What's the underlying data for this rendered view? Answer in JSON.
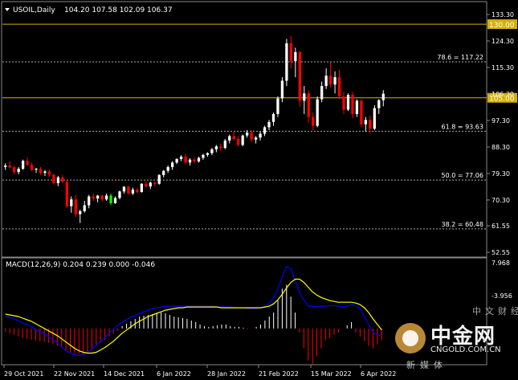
{
  "chart_data": {
    "type": "candlestick",
    "symbol_label": "USOIL,Daily",
    "ohlc_header": "104.20 107.58 102.09 106.37",
    "price_ticks": [
      "133.30",
      "124.30",
      "115.30",
      "106.30",
      "97.30",
      "88.30",
      "79.30",
      "70.30",
      "61.55",
      "52.55"
    ],
    "x_labels": [
      "29 Oct 2021",
      "22 Nov 2021",
      "14 Dec 2021",
      "6 Jan 2022",
      "28 Jan 2022",
      "21 Feb 2022",
      "15 Mar 2022",
      "6 Apr 2022"
    ],
    "candles": [
      [
        81.5,
        82.8,
        80.5,
        82.0
      ],
      [
        82.0,
        83.5,
        81.0,
        81.4
      ],
      [
        81.4,
        82.0,
        79.0,
        79.8
      ],
      [
        79.8,
        81.5,
        79.0,
        80.9
      ],
      [
        80.9,
        84.0,
        80.5,
        83.6
      ],
      [
        83.6,
        84.8,
        82.0,
        82.2
      ],
      [
        82.2,
        83.0,
        80.0,
        80.6
      ],
      [
        80.6,
        81.2,
        79.5,
        80.9
      ],
      [
        80.9,
        81.5,
        78.8,
        79.5
      ],
      [
        79.5,
        80.5,
        78.5,
        80.0
      ],
      [
        80.0,
        80.7,
        78.2,
        78.9
      ],
      [
        78.9,
        79.2,
        75.5,
        76.0
      ],
      [
        76.0,
        78.5,
        75.0,
        78.0
      ],
      [
        78.0,
        78.8,
        76.0,
        76.5
      ],
      [
        76.5,
        77.0,
        67.5,
        68.2
      ],
      [
        68.2,
        71.5,
        66.0,
        70.5
      ],
      [
        70.5,
        72.0,
        64.5,
        65.5
      ],
      [
        65.5,
        67.0,
        62.5,
        66.5
      ],
      [
        66.5,
        70.0,
        66.0,
        68.5
      ],
      [
        68.5,
        72.0,
        67.5,
        71.5
      ],
      [
        71.5,
        72.5,
        70.0,
        70.8
      ],
      [
        70.8,
        72.0,
        69.5,
        71.8
      ],
      [
        71.8,
        72.0,
        69.8,
        70.5
      ],
      [
        70.5,
        72.5,
        70.0,
        71.8
      ],
      [
        71.8,
        72.5,
        68.5,
        69.2
      ],
      [
        69.2,
        71.5,
        69.0,
        71.0
      ],
      [
        71.0,
        73.5,
        70.5,
        73.2
      ],
      [
        73.2,
        75.0,
        72.5,
        74.8
      ],
      [
        74.8,
        75.0,
        72.0,
        72.5
      ],
      [
        72.5,
        74.5,
        72.0,
        73.8
      ],
      [
        73.8,
        74.5,
        72.5,
        73.0
      ],
      [
        73.0,
        76.0,
        72.8,
        75.8
      ],
      [
        75.8,
        76.8,
        74.5,
        74.9
      ],
      [
        74.9,
        76.5,
        74.0,
        76.2
      ],
      [
        76.2,
        76.5,
        75.0,
        75.8
      ],
      [
        75.8,
        79.0,
        75.5,
        78.8
      ],
      [
        78.8,
        80.5,
        78.0,
        80.2
      ],
      [
        80.2,
        82.0,
        79.5,
        81.5
      ],
      [
        81.5,
        83.5,
        80.5,
        83.0
      ],
      [
        83.0,
        84.5,
        82.5,
        84.2
      ],
      [
        84.2,
        85.5,
        83.5,
        85.0
      ],
      [
        85.0,
        86.0,
        82.5,
        83.0
      ],
      [
        83.0,
        84.5,
        82.0,
        84.0
      ],
      [
        84.0,
        84.8,
        82.8,
        83.4
      ],
      [
        83.4,
        85.0,
        83.0,
        84.6
      ],
      [
        84.6,
        86.0,
        84.0,
        85.6
      ],
      [
        85.6,
        86.5,
        85.0,
        86.2
      ],
      [
        86.2,
        88.0,
        85.5,
        87.5
      ],
      [
        87.5,
        89.0,
        86.5,
        88.5
      ],
      [
        88.5,
        89.5,
        87.0,
        88.0
      ],
      [
        88.0,
        91.0,
        87.5,
        90.5
      ],
      [
        90.5,
        92.5,
        89.5,
        92.0
      ],
      [
        92.0,
        93.5,
        90.5,
        91.0
      ],
      [
        91.0,
        92.0,
        88.5,
        89.0
      ],
      [
        89.0,
        92.5,
        88.5,
        92.2
      ],
      [
        92.2,
        94.0,
        91.5,
        93.2
      ],
      [
        93.2,
        94.0,
        90.0,
        90.8
      ],
      [
        90.8,
        92.0,
        89.5,
        91.5
      ],
      [
        91.5,
        93.5,
        90.5,
        92.8
      ],
      [
        92.8,
        95.5,
        92.0,
        95.0
      ],
      [
        95.0,
        97.5,
        94.0,
        96.8
      ],
      [
        96.8,
        100.0,
        95.5,
        99.5
      ],
      [
        99.5,
        105.5,
        98.5,
        104.8
      ],
      [
        104.8,
        112.0,
        103.5,
        110.8
      ],
      [
        110.8,
        125.0,
        109.0,
        123.5
      ],
      [
        123.5,
        126.0,
        115.0,
        117.5
      ],
      [
        117.5,
        122.0,
        112.0,
        120.5
      ],
      [
        120.5,
        121.0,
        102.0,
        104.0
      ],
      [
        104.0,
        109.0,
        99.5,
        106.5
      ],
      [
        106.5,
        107.5,
        96.5,
        98.5
      ],
      [
        98.5,
        100.0,
        94.0,
        95.5
      ],
      [
        95.5,
        105.5,
        95.0,
        104.5
      ],
      [
        104.5,
        110.5,
        103.5,
        109.0
      ],
      [
        109.0,
        115.0,
        108.0,
        112.5
      ],
      [
        112.5,
        117.0,
        108.5,
        109.5
      ],
      [
        109.5,
        114.0,
        106.5,
        112.0
      ],
      [
        112.0,
        114.5,
        104.5,
        105.5
      ],
      [
        105.5,
        107.0,
        99.5,
        101.0
      ],
      [
        101.0,
        106.5,
        100.5,
        106.0
      ],
      [
        106.0,
        107.0,
        98.0,
        99.5
      ],
      [
        99.5,
        104.5,
        98.5,
        104.0
      ],
      [
        104.0,
        104.5,
        95.0,
        96.0
      ],
      [
        96.0,
        98.5,
        93.5,
        97.5
      ],
      [
        97.5,
        99.0,
        93.0,
        94.5
      ],
      [
        94.5,
        102.5,
        94.0,
        101.5
      ],
      [
        101.5,
        104.5,
        99.5,
        104.2
      ],
      [
        104.2,
        107.6,
        102.1,
        106.4
      ]
    ],
    "hlines": [
      {
        "value": 130.0,
        "label": "130.00",
        "style": "solid",
        "color": "#d4b000"
      },
      {
        "value": 117.22,
        "label": "78.6 = 117.22",
        "style": "dash",
        "color": "#aaaaaa"
      },
      {
        "value": 105.0,
        "label": "105.00",
        "style": "solid",
        "color": "#d4b000"
      },
      {
        "value": 93.63,
        "label": "61.8 = 93.63",
        "style": "dash",
        "color": "#aaaaaa"
      },
      {
        "value": 77.06,
        "label": "50.0 = 77.06",
        "style": "dash",
        "color": "#aaaaaa"
      },
      {
        "value": 60.48,
        "label": "38.2 = 60.48",
        "style": "dash",
        "color": "#aaaaaa"
      }
    ],
    "macd": {
      "header": "MACD(12,26,9) 0.204 0.239 0.000 -0.046",
      "ticks": [
        "7.968",
        "-3.956"
      ],
      "hist": [
        -0.4,
        -0.6,
        -0.8,
        -1.0,
        -1.2,
        -1.3,
        -1.4,
        -1.5,
        -1.6,
        -1.7,
        -1.8,
        -2.0,
        -2.2,
        -2.4,
        -2.8,
        -3.0,
        -3.1,
        -3.2,
        -3.2,
        -3.0,
        -2.6,
        -2.2,
        -1.8,
        -1.4,
        -1.0,
        -0.6,
        -0.3,
        0.3,
        0.6,
        0.9,
        1.2,
        1.5,
        1.6,
        1.7,
        1.8,
        1.9,
        2.0,
        1.9,
        1.7,
        1.5,
        1.4,
        1.3,
        1.2,
        1.0,
        0.8,
        0.5,
        0.3,
        0.2,
        0.3,
        0.4,
        0.5,
        0.5,
        0.3,
        0.2,
        0.2,
        0.1,
        -0.1,
        0.0,
        0.2,
        0.5,
        1.0,
        1.5,
        2.0,
        3.5,
        5.0,
        5.5,
        4.0,
        2.0,
        -0.5,
        -2.5,
        -4.0,
        -4.5,
        -3.5,
        -2.5,
        -1.5,
        -1.2,
        -0.8,
        -0.5,
        0.0,
        0.4,
        0.8,
        -0.5,
        -1.0,
        -1.6,
        -2.2,
        -2.5,
        -2.0,
        -1.5
      ],
      "line": [
        1.5,
        1.4,
        1.2,
        1.0,
        0.7,
        0.5,
        0.2,
        -0.1,
        -0.4,
        -0.7,
        -1.0,
        -1.4,
        -1.8,
        -2.3,
        -2.8,
        -3.1,
        -3.3,
        -3.4,
        -3.3,
        -3.0,
        -2.6,
        -2.1,
        -1.6,
        -1.1,
        -0.6,
        -0.1,
        0.4,
        0.8,
        1.1,
        1.4,
        1.6,
        1.9,
        2.1,
        2.3,
        2.5,
        2.6,
        2.7,
        2.8,
        2.8,
        2.8,
        2.8,
        2.8,
        2.8,
        2.8,
        2.8,
        2.8,
        2.8,
        2.8,
        2.8,
        2.7,
        2.7,
        2.7,
        2.7,
        2.6,
        2.6,
        2.6,
        2.5,
        2.5,
        2.5,
        2.6,
        2.8,
        3.2,
        3.8,
        5.0,
        6.5,
        7.8,
        7.5,
        6.0,
        4.5,
        3.6,
        2.8,
        2.8,
        2.7,
        2.8,
        2.8,
        2.9,
        2.9,
        2.8,
        2.7,
        2.8,
        3.0,
        2.9,
        2.5,
        1.5,
        0.5,
        -0.5,
        -0.8,
        -0.9
      ],
      "signal": [
        1.8,
        1.7,
        1.6,
        1.5,
        1.3,
        1.1,
        0.9,
        0.6,
        0.3,
        0.0,
        -0.3,
        -0.6,
        -0.9,
        -1.3,
        -1.7,
        -2.1,
        -2.5,
        -2.8,
        -3.0,
        -3.1,
        -3.1,
        -3.0,
        -2.7,
        -2.4,
        -2.0,
        -1.6,
        -1.1,
        -0.6,
        -0.2,
        0.2,
        0.6,
        0.9,
        1.2,
        1.5,
        1.7,
        1.9,
        2.1,
        2.3,
        2.4,
        2.5,
        2.6,
        2.6,
        2.7,
        2.7,
        2.7,
        2.7,
        2.7,
        2.7,
        2.7,
        2.7,
        2.6,
        2.6,
        2.6,
        2.6,
        2.6,
        2.6,
        2.6,
        2.6,
        2.6,
        2.6,
        2.7,
        2.8,
        3.1,
        3.6,
        4.3,
        5.1,
        5.8,
        6.2,
        6.2,
        5.8,
        5.2,
        4.6,
        4.2,
        3.9,
        3.7,
        3.5,
        3.4,
        3.3,
        3.3,
        3.3,
        3.3,
        3.2,
        3.0,
        2.6,
        2.0,
        1.2,
        0.5,
        -0.2
      ],
      "range": [
        -3.956,
        7.968
      ]
    },
    "colors": {
      "bull": "#ffffff",
      "bear": "#ff0000",
      "green": "#00ff00",
      "macd_line": "#0000ff",
      "signal_line": "#ffff00",
      "hist_pos": "#ffffff",
      "hist_neg": "#ff0000",
      "hline_solid": "#d4b000",
      "hline_dash": "#aaaaaa"
    }
  },
  "watermark": {
    "title": "中金网",
    "site": "CNGOLD.COM.CN",
    "tagline_top": "中文财经",
    "tagline_bottom": "新媒体"
  }
}
